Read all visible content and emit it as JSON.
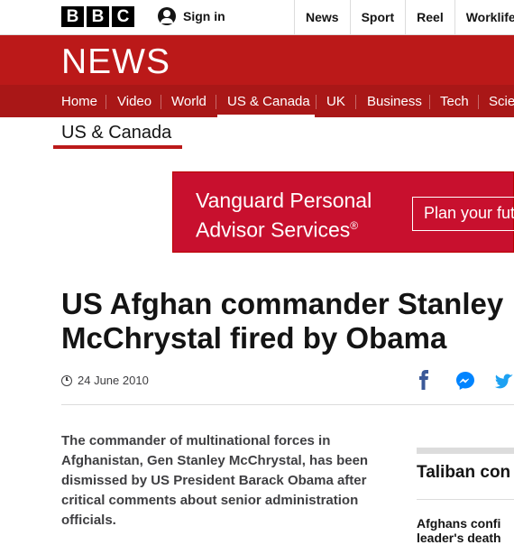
{
  "masthead": {
    "logo_letters": [
      "B",
      "B",
      "C"
    ],
    "sign_in_label": "Sign in",
    "nav": [
      "News",
      "Sport",
      "Reel",
      "Worklife"
    ]
  },
  "banner": {
    "title": "NEWS"
  },
  "section_nav": {
    "items": [
      "Home",
      "Video",
      "World",
      "US & Canada",
      "UK",
      "Business",
      "Tech",
      "Scie"
    ],
    "active": "US & Canada"
  },
  "section_heading": "US & Canada",
  "ad": {
    "line1": "Vanguard Personal",
    "line2": "Advisor Services",
    "trademark": "®",
    "button_label": "Plan your fut",
    "background_color": "#c8102e"
  },
  "article": {
    "headline": "US Afghan commander Stanley McChrystal fired by Obama",
    "date": "24 June 2010",
    "intro": "The commander of multinational forces in Afghanistan, Gen Stanley McChrystal, has been dismissed by US President Barack Obama after critical comments about senior administration officials."
  },
  "share_icons": [
    "facebook-icon",
    "messenger-icon",
    "twitter-icon"
  ],
  "sidebar": {
    "title": "Taliban con",
    "item_line1": "Afghans confi",
    "item_line2": "leader's death"
  },
  "colors": {
    "brand_red": "#bb1919",
    "nav_red": "#a91717",
    "facebook_blue": "#3b5998",
    "messenger_blue": "#0084ff",
    "twitter_blue": "#1da1f2"
  }
}
